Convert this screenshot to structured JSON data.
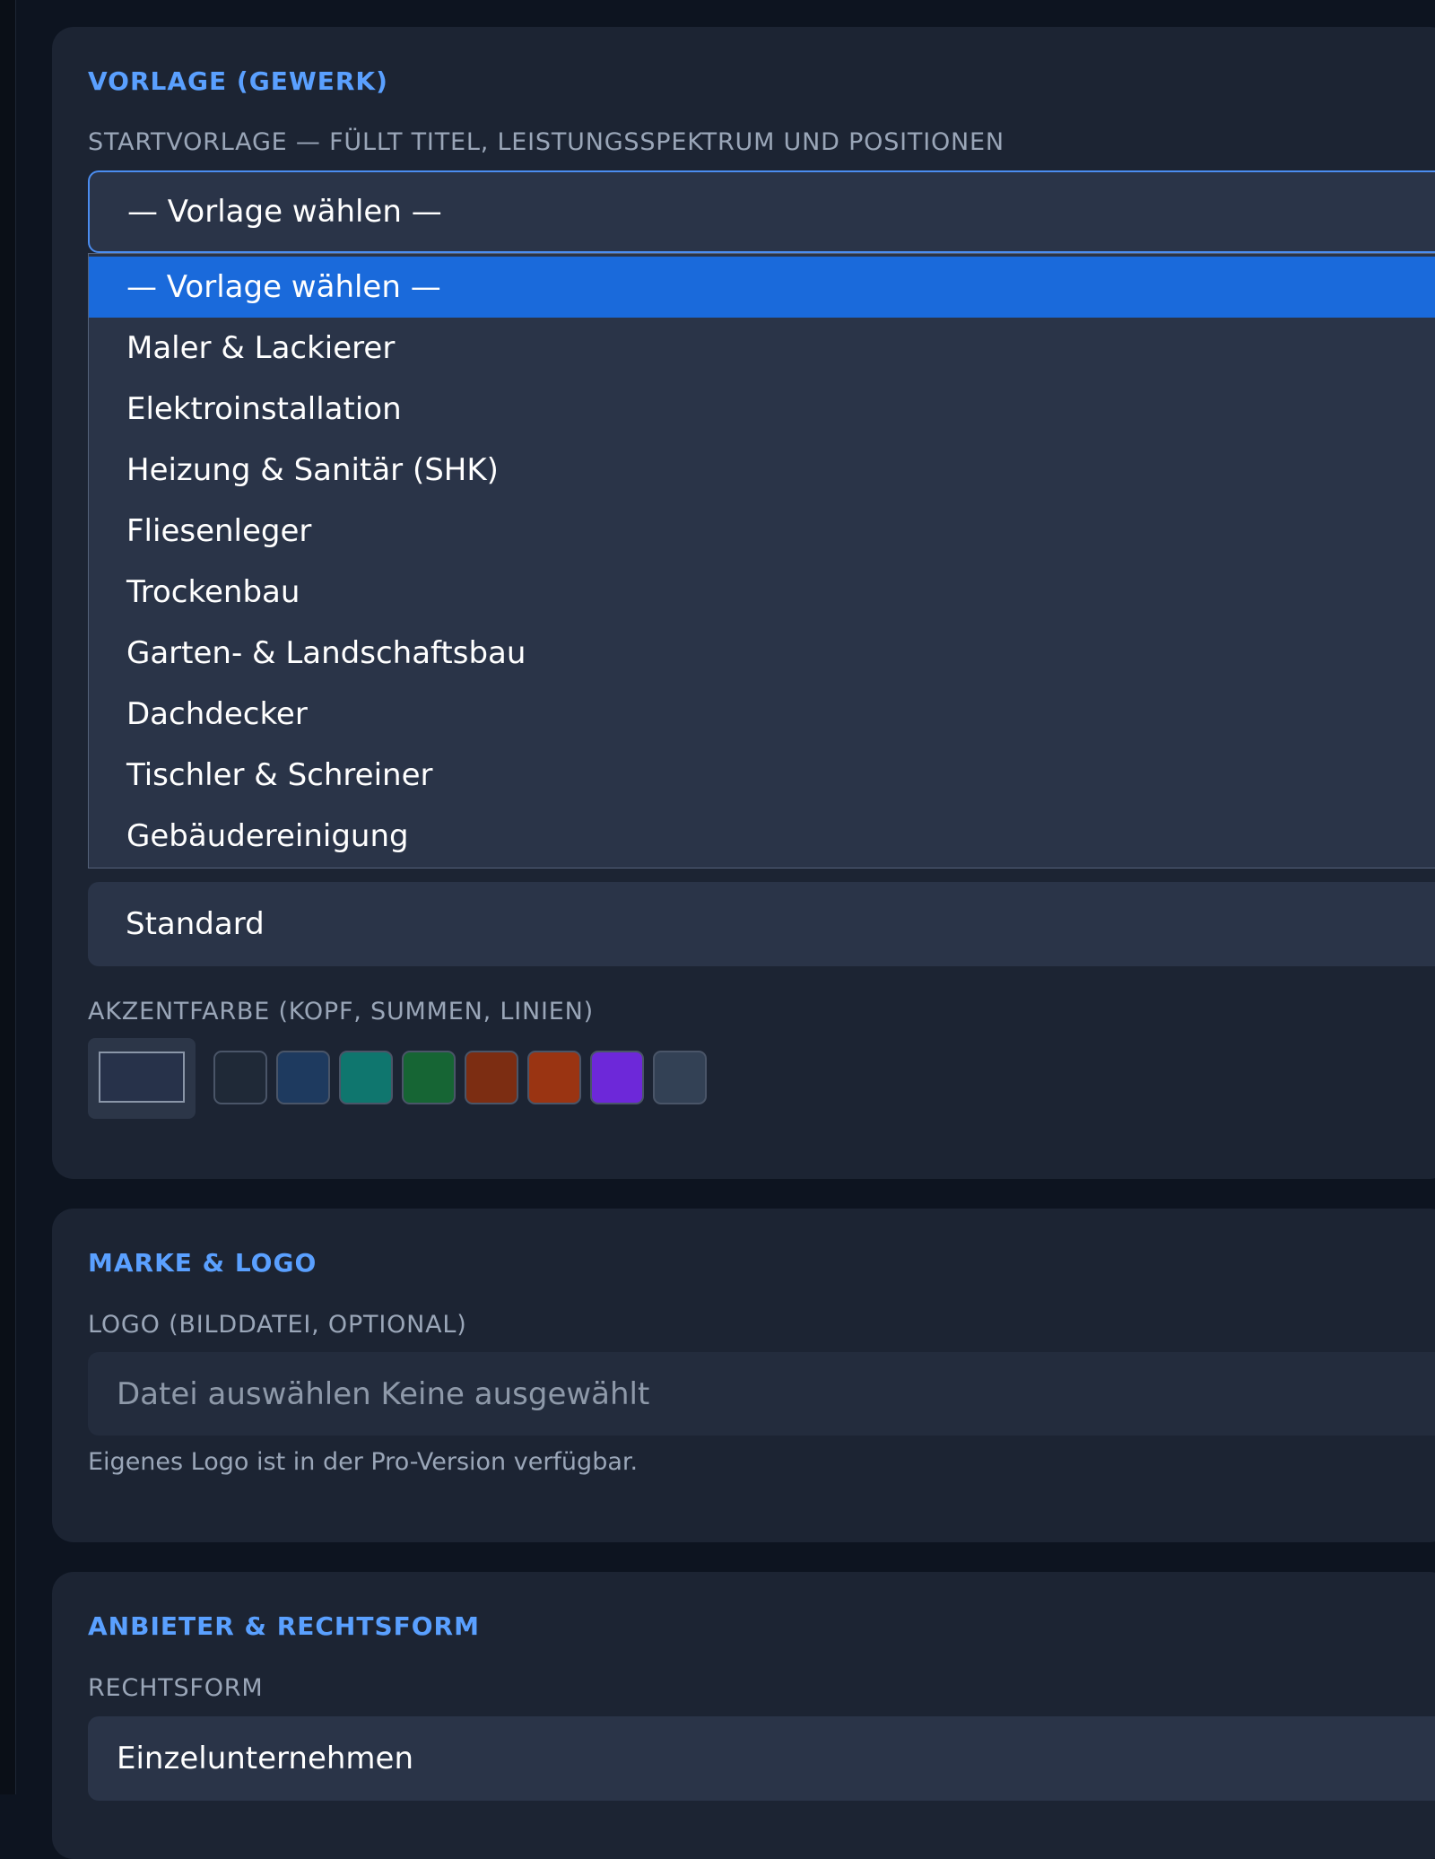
{
  "template_section": {
    "title": "VORLAGE (GEWERK)",
    "label": "STARTVORLAGE — FÜLLT TITEL, LEISTUNGSSPEKTRUM UND POSITIONEN",
    "selected_value": "— Vorlage wählen —",
    "options": [
      "— Vorlage wählen —",
      "Maler & Lackierer",
      "Elektroinstallation",
      "Heizung & Sanitär (SHK)",
      "Fliesenleger",
      "Trockenbau",
      "Garten- & Landschaftsbau",
      "Dachdecker",
      "Tischler & Schreiner",
      "Gebäudereinigung"
    ],
    "style_value": "Standard",
    "accent_label": "AKZENTFARBE (KOPF, SUMMEN, LINIEN)",
    "accent_current": "#27324a",
    "accent_swatches": [
      "#1f2937",
      "#1e3a5f",
      "#0f766e",
      "#166534",
      "#7c2d12",
      "#9a3412",
      "#6d28d9",
      "#334155"
    ]
  },
  "brand_section": {
    "title": "MARKE & LOGO",
    "logo_label": "LOGO (BILDDATEI, OPTIONAL)",
    "file_input_text": "Datei auswählen Keine ausgewählt",
    "hint": "Eigenes Logo ist in der Pro-Version verfügbar."
  },
  "provider_section": {
    "title": "ANBIETER & RECHTSFORM",
    "legal_form_label": "RECHTSFORM",
    "legal_form_value": "Einzelunternehmen"
  }
}
